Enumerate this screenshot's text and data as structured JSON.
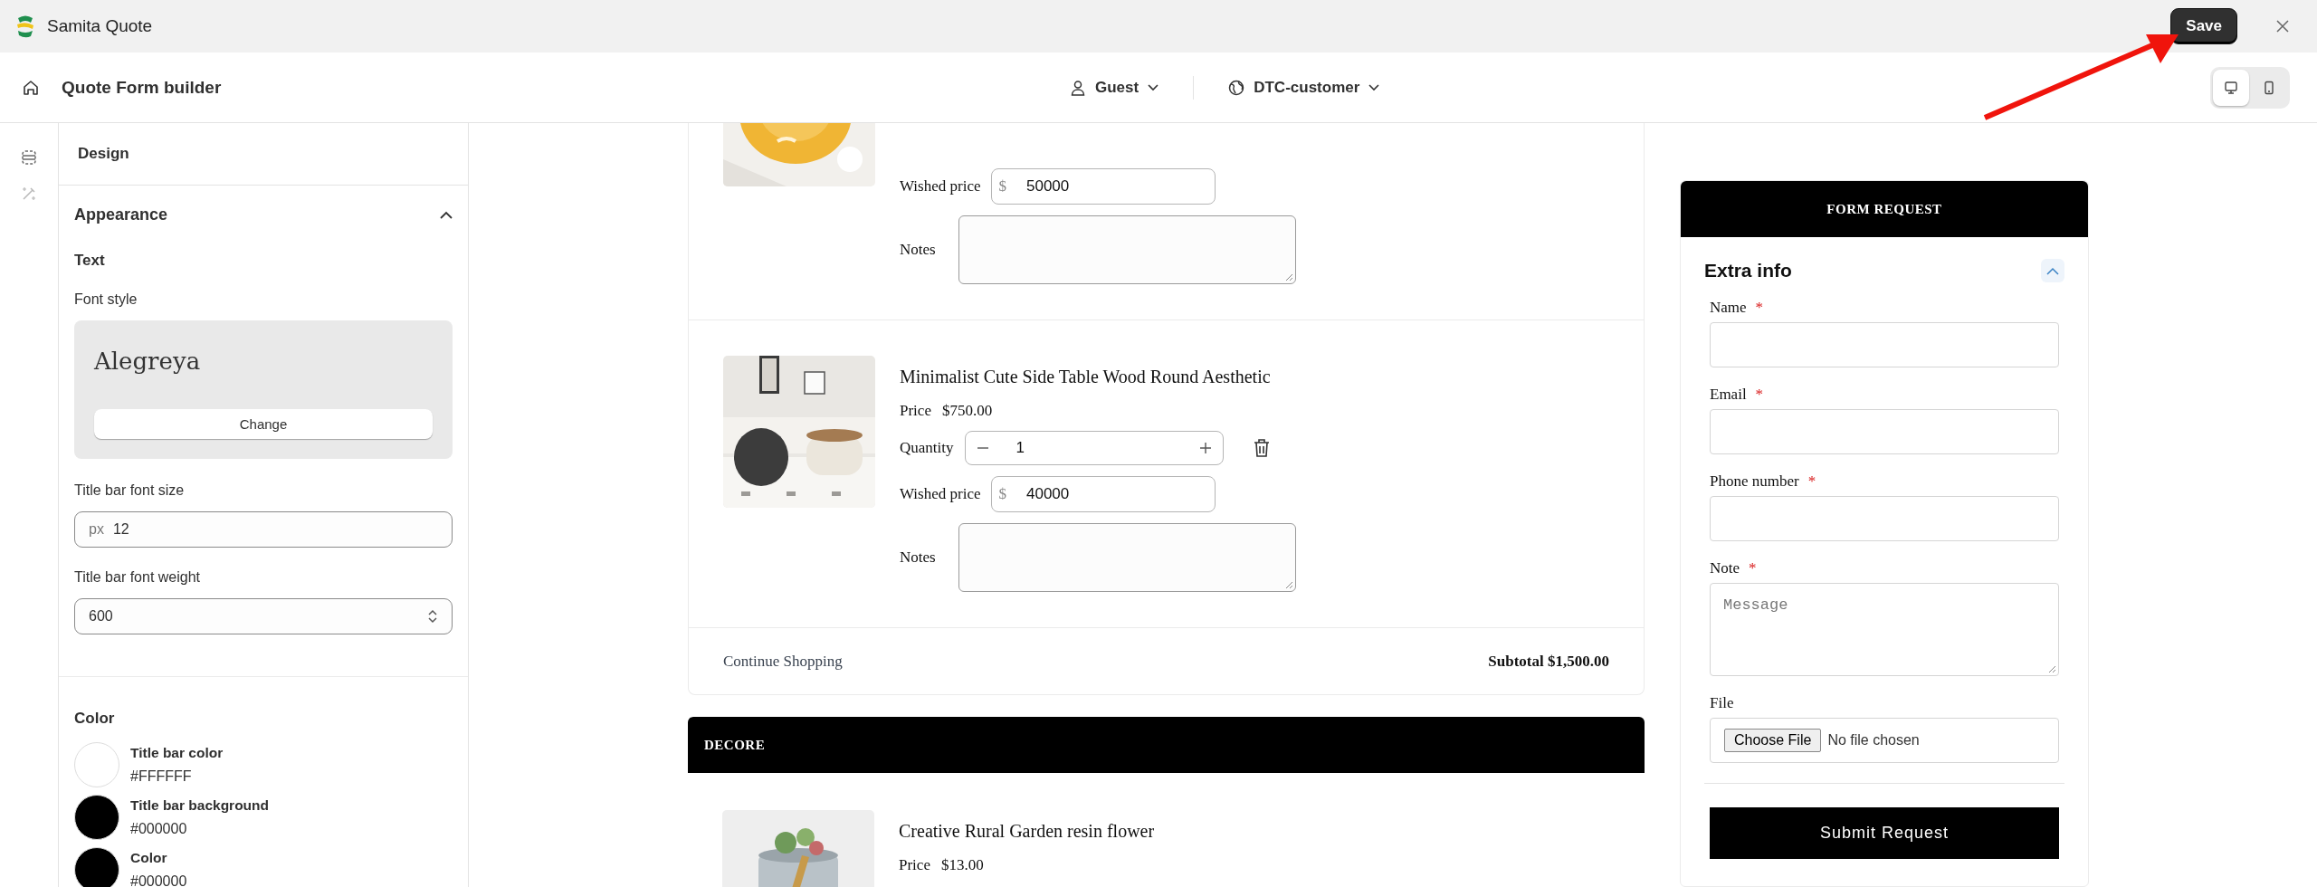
{
  "app": {
    "title": "Samita Quote",
    "save": "Save"
  },
  "header": {
    "title": "Quote Form builder",
    "customer": "Guest",
    "segment": "DTC-customer",
    "views": [
      {
        "kind": "desktop",
        "selected": true
      },
      {
        "kind": "mobile",
        "selected": false
      }
    ]
  },
  "rail": [
    {
      "kind": "layout",
      "selected": true
    },
    {
      "kind": "magic",
      "selected": false
    }
  ],
  "sidebar": {
    "title": "Design",
    "section": {
      "title": "Appearance",
      "expanded": true
    },
    "text_heading": "Text",
    "font_style_label": "Font style",
    "font_name": "Alegreya",
    "change": "Change",
    "size_label": "Title bar font size",
    "size_unit": "px",
    "size_value": "12",
    "weight_label": "Title bar font weight",
    "weight_value": "600",
    "color_heading": "Color",
    "colors": [
      {
        "label": "Title bar color",
        "value": "#FFFFFF",
        "color": "#ffffff"
      },
      {
        "label": "Title bar background",
        "value": "#000000",
        "color": "#000000"
      },
      {
        "label": "Color",
        "value": "#000000",
        "color": "#000000"
      }
    ]
  },
  "cart": {
    "products": [
      {
        "kind": "partial",
        "wished_label": "Wished price",
        "currency": "$",
        "wished": "50000",
        "notes_label": "Notes"
      },
      {
        "kind": "full",
        "title": "Minimalist Cute Side Table Wood Round Aesthetic",
        "price_label": "Price",
        "price": "$750.00",
        "quantity_label": "Quantity",
        "quantity": "1",
        "wished_label": "Wished price",
        "currency": "$",
        "wished": "40000",
        "notes_label": "Notes"
      }
    ],
    "continue": "Continue Shopping",
    "subtotal": "Subtotal $1,500.00"
  },
  "group": {
    "title": "DECORE",
    "products": [
      {
        "kind": "top",
        "title": "Creative Rural Garden resin flower",
        "price_label": "Price",
        "price": "$13.00"
      }
    ]
  },
  "form": {
    "title": "FORM REQUEST",
    "section": "Extra info",
    "expanded": true,
    "required_mark": "*",
    "fields": [
      {
        "kind": "text",
        "label": "Name",
        "required": true
      },
      {
        "kind": "text",
        "label": "Email",
        "required": true
      },
      {
        "kind": "text",
        "label": "Phone number",
        "required": true
      },
      {
        "kind": "textarea",
        "label": "Note",
        "required": true,
        "placeholder": "Message"
      },
      {
        "kind": "file",
        "label": "File",
        "required": false,
        "button": "Choose File",
        "status": "No file chosen"
      }
    ],
    "submit": "Submit Request"
  }
}
